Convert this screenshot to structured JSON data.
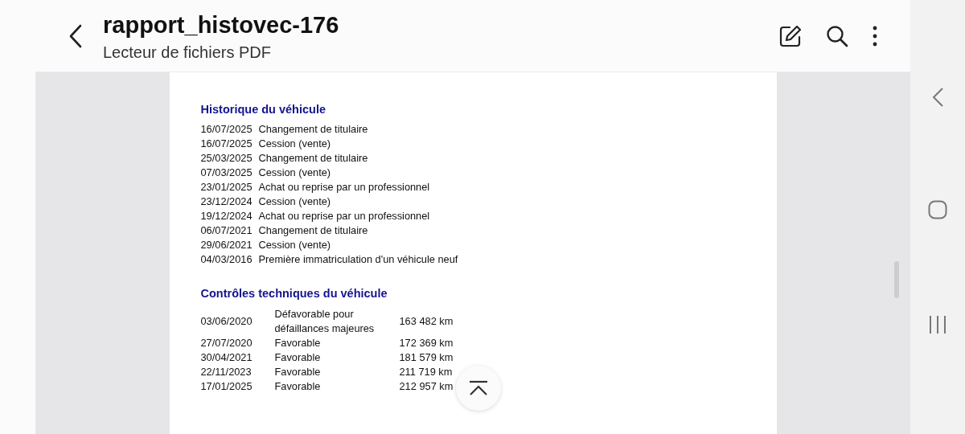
{
  "header": {
    "title": "rapport_histovec-176",
    "subtitle": "Lecteur de fichiers PDF"
  },
  "history": {
    "title": "Historique du véhicule",
    "rows": [
      {
        "date": "16/07/2025",
        "event": "Changement de titulaire"
      },
      {
        "date": "16/07/2025",
        "event": "Cession (vente)"
      },
      {
        "date": "25/03/2025",
        "event": "Changement de titulaire"
      },
      {
        "date": "07/03/2025",
        "event": "Cession (vente)"
      },
      {
        "date": "23/01/2025",
        "event": "Achat ou reprise par un professionnel"
      },
      {
        "date": "23/12/2024",
        "event": "Cession (vente)"
      },
      {
        "date": "19/12/2024",
        "event": "Achat ou reprise par un professionnel"
      },
      {
        "date": "06/07/2021",
        "event": "Changement de titulaire"
      },
      {
        "date": "29/06/2021",
        "event": "Cession (vente)"
      },
      {
        "date": "04/03/2016",
        "event": "Première immatriculation d'un véhicule neuf"
      }
    ]
  },
  "inspections": {
    "title": "Contrôles techniques du véhicule",
    "rows": [
      {
        "date": "03/06/2020",
        "result": "Défavorable pour défaillances majeures",
        "mileage": "163 482 km"
      },
      {
        "date": "27/07/2020",
        "result": "Favorable",
        "mileage": "172 369 km"
      },
      {
        "date": "30/04/2021",
        "result": "Favorable",
        "mileage": "181 579 km"
      },
      {
        "date": "22/11/2023",
        "result": "Favorable",
        "mileage": "211 719 km"
      },
      {
        "date": "17/01/2025",
        "result": "Favorable",
        "mileage": "212 957 km"
      }
    ]
  }
}
